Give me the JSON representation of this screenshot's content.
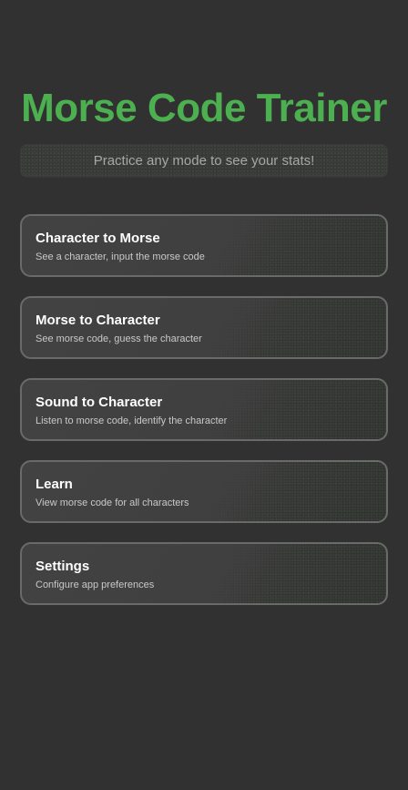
{
  "app": {
    "title": "Morse Code Trainer",
    "stats_message": "Practice any mode to see your stats!"
  },
  "menu": {
    "items": [
      {
        "label": "Character to Morse",
        "description": "See a character, input the morse code"
      },
      {
        "label": "Morse to Character",
        "description": "See morse code, guess the character"
      },
      {
        "label": "Sound to Character",
        "description": "Listen to morse code, identify the character"
      },
      {
        "label": "Learn",
        "description": "View morse code for all characters"
      },
      {
        "label": "Settings",
        "description": "Configure app preferences"
      }
    ]
  },
  "colors": {
    "background": "#313131",
    "accent": "#4caf50",
    "card_border": "#6a6a6a"
  }
}
